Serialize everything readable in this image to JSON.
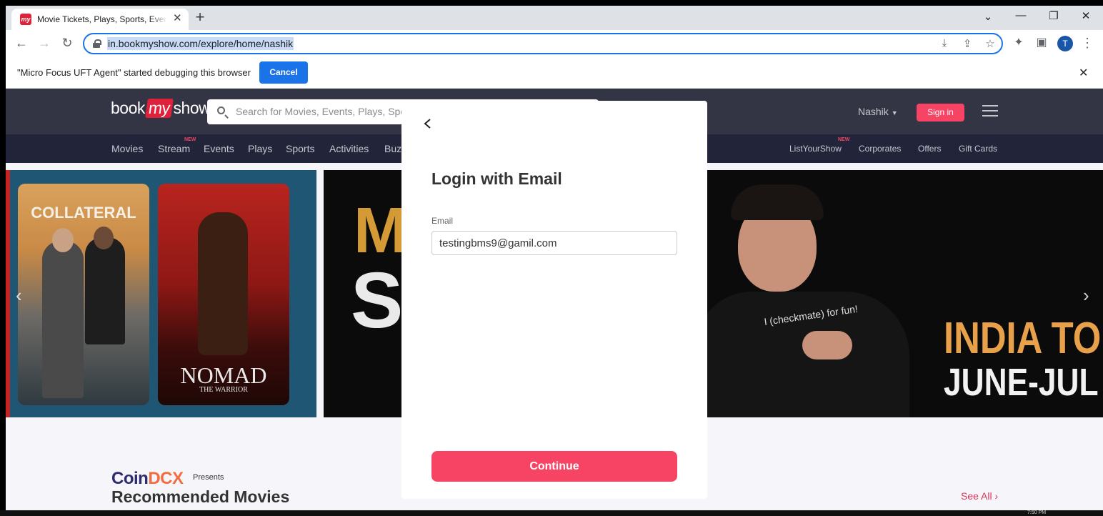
{
  "browser": {
    "tab_title": "Movie Tickets, Plays, Sports, Events & Cinemas nearby",
    "favicon_text": "my",
    "url": "in.bookmyshow.com/explore/home/nashik",
    "avatar_letter": "T",
    "infobar_text": "\"Micro Focus UFT Agent\" started debugging this browser",
    "infobar_cancel": "Cancel"
  },
  "site": {
    "logo_left": "book",
    "logo_my": "my",
    "logo_right": "show",
    "search_placeholder": "Search for Movies, Events, Plays, Sports and Activities",
    "city": "Nashik",
    "signin": "Sign in",
    "nav_left": [
      "Movies",
      "Stream",
      "Events",
      "Plays",
      "Sports",
      "Activities",
      "Buzz"
    ],
    "nav_right": [
      "ListYourShow",
      "Corporates",
      "Offers",
      "Gift Cards"
    ],
    "new_badge": "NEW"
  },
  "banner": {
    "poster1_title": "COLLATERAL",
    "poster2_title": "NOMAD",
    "poster2_sub": "THE WARRIOR",
    "big_m": "M",
    "big_s": "SA",
    "shirt_text": "I (checkmate) for fun!",
    "india": "INDIA TO",
    "june": "JUNE-JUL"
  },
  "section": {
    "brand_a": "Coin",
    "brand_b": "DCX",
    "presents": "Presents",
    "title": "Recommended Movies",
    "see_all": "See All ›"
  },
  "modal": {
    "title": "Login with Email",
    "email_label": "Email",
    "email_value": "testingbms9@gamil.com",
    "continue": "Continue"
  },
  "taskbar": {
    "clock": "7:50 PM"
  },
  "colors": {
    "accent": "#f84464",
    "header_bg": "#333545",
    "nav_bg": "#222539",
    "chrome_blue": "#1a73e8"
  }
}
